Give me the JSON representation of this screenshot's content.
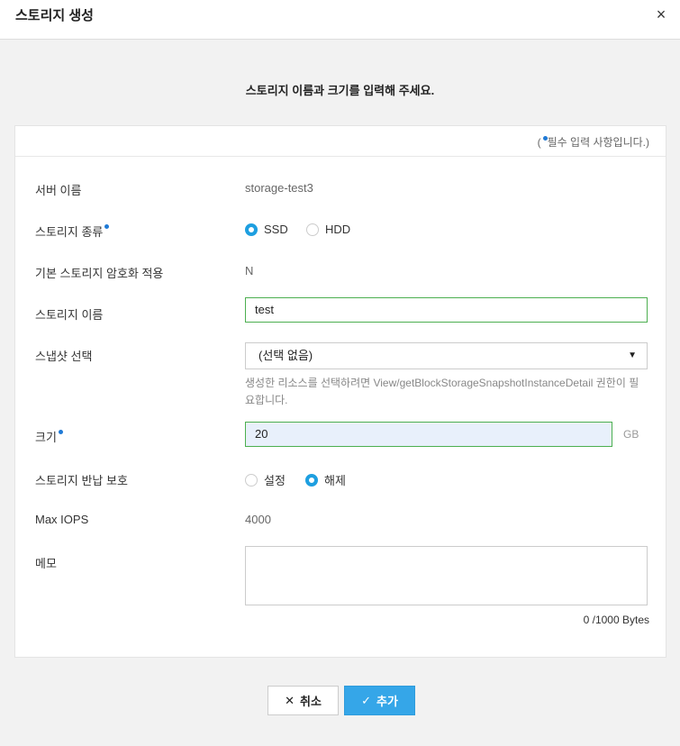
{
  "dialog": {
    "title": "스토리지 생성",
    "close_icon": "×"
  },
  "subtitle": "스토리지 이름과 크기를 입력해 주세요.",
  "required_note": {
    "open": "(",
    "text": "필수 입력 사항입니다.)"
  },
  "accent_color": "#1e9fe0",
  "fields": {
    "server_name": {
      "label": "서버 이름",
      "value": "storage-test3"
    },
    "storage_type": {
      "label": "스토리지 종류",
      "options": [
        "SSD",
        "HDD"
      ],
      "selected": "SSD"
    },
    "encryption": {
      "label": "기본 스토리지 암호화 적용",
      "value": "N"
    },
    "storage_name": {
      "label": "스토리지 이름",
      "value": "test"
    },
    "snapshot": {
      "label": "스냅샷 선택",
      "selected": "(선택 없음)",
      "help": "생성한 리소스를 선택하려면 View/getBlockStorageSnapshotInstanceDetail 권한이 필요합니다."
    },
    "size": {
      "label": "크기",
      "value": "20",
      "unit": "GB"
    },
    "return_protection": {
      "label": "스토리지 반납 보호",
      "options": [
        "설정",
        "해제"
      ],
      "selected": "해제"
    },
    "max_iops": {
      "label": "Max IOPS",
      "value": "4000"
    },
    "memo": {
      "label": "메모",
      "value": "",
      "counter": "0 /1000 Bytes"
    }
  },
  "buttons": {
    "cancel": "취소",
    "add": "추가"
  }
}
